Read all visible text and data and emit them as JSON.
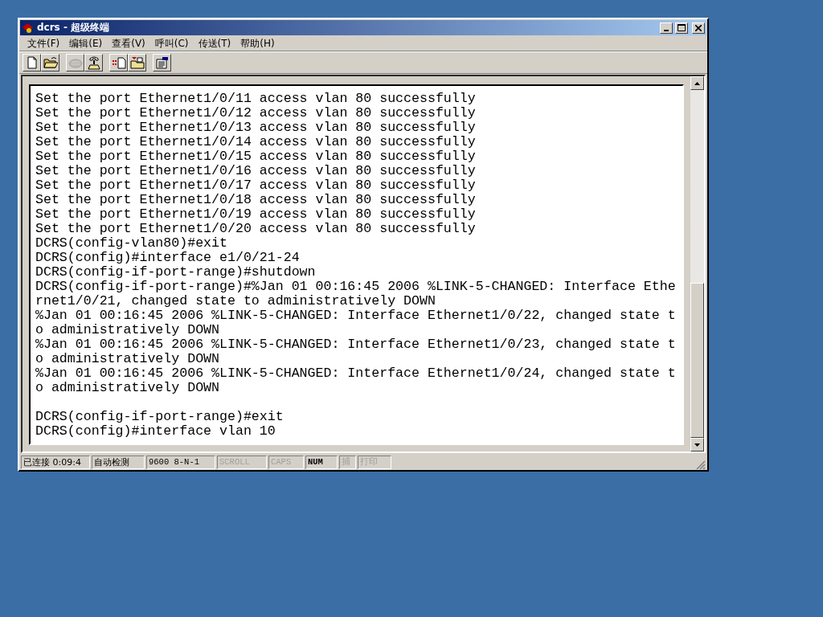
{
  "window": {
    "title": "dcrs - 超级终端"
  },
  "menu": [
    "文件(F)",
    "编辑(E)",
    "查看(V)",
    "呼叫(C)",
    "传送(T)",
    "帮助(H)"
  ],
  "toolbar": [
    [
      {
        "kind": "new",
        "disabled": false
      },
      {
        "kind": "open",
        "disabled": false
      }
    ],
    [
      {
        "kind": "call",
        "disabled": true
      },
      {
        "kind": "hangup",
        "disabled": false
      }
    ],
    [
      {
        "kind": "send",
        "disabled": false
      },
      {
        "kind": "receive",
        "disabled": false
      }
    ],
    [
      {
        "kind": "properties",
        "disabled": false
      }
    ]
  ],
  "terminal": {
    "paragraphs": [
      [
        "Set the port Ethernet1/0/11 access vlan 80 successfully",
        "Set the port Ethernet1/0/12 access vlan 80 successfully",
        "Set the port Ethernet1/0/13 access vlan 80 successfully",
        "Set the port Ethernet1/0/14 access vlan 80 successfully",
        "Set the port Ethernet1/0/15 access vlan 80 successfully",
        "Set the port Ethernet1/0/16 access vlan 80 successfully",
        "Set the port Ethernet1/0/17 access vlan 80 successfully",
        "Set the port Ethernet1/0/18 access vlan 80 successfully",
        "Set the port Ethernet1/0/19 access vlan 80 successfully",
        "Set the port Ethernet1/0/20 access vlan 80 successfully",
        "DCRS(config-vlan80)#exit",
        "DCRS(config)#interface e1/0/21-24",
        "DCRS(config-if-port-range)#shutdown",
        "DCRS(config-if-port-range)#%Jan 01 00:16:45 2006 %LINK-5-CHANGED: Interface Ethe",
        "rnet1/0/21, changed state to administratively DOWN",
        "%Jan 01 00:16:45 2006 %LINK-5-CHANGED: Interface Ethernet1/0/22, changed state t",
        "o administratively DOWN",
        "%Jan 01 00:16:45 2006 %LINK-5-CHANGED: Interface Ethernet1/0/23, changed state t",
        "o administratively DOWN",
        "%Jan 01 00:16:45 2006 %LINK-5-CHANGED: Interface Ethernet1/0/24, changed state t",
        "o administratively DOWN"
      ],
      [
        "DCRS(config-if-port-range)#exit",
        "DCRS(config)#interface vlan 10"
      ]
    ]
  },
  "status_bar": [
    {
      "text": "已连接 0:09:4"
    },
    {
      "text": "自动检测"
    },
    {
      "text": "9600 8-N-1"
    },
    {
      "text": "SCROLL",
      "on": false
    },
    {
      "text": "CAPS",
      "on": false
    },
    {
      "text": "NUM",
      "on": true
    },
    {
      "text": "捕",
      "on": false
    },
    {
      "text": "打印",
      "on": false
    }
  ]
}
